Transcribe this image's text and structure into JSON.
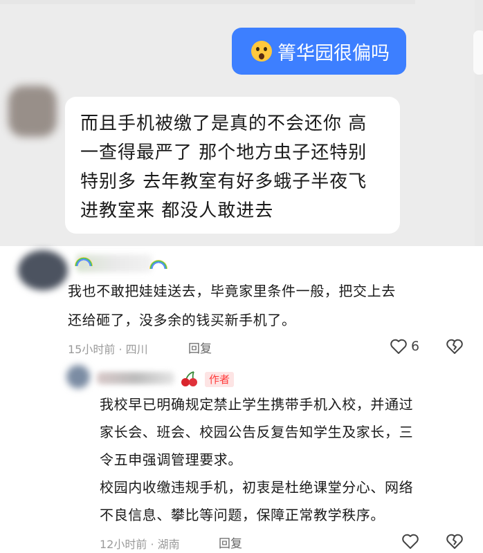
{
  "chat": {
    "outgoing_message": "箐华园很偏吗",
    "incoming_lines": [
      "而且手机被缴了是真的不会还你 高",
      "一查得最严了 那个地方虫子还特别",
      "特别多 去年教室有好多蛾子半夜飞",
      "进教室来 都没人敢进去"
    ]
  },
  "comments": [
    {
      "text_lines": [
        "我也不敢把娃娃送去，毕竟家里条件一般，把交上去",
        "还给砸了，没多余的钱买新手机了。"
      ],
      "time": "15小时前 · 四川",
      "reply_label": "回复",
      "likes": "6"
    },
    {
      "badge": "作者",
      "text_lines": [
        "我校早已明确规定禁止学生携带手机入校，并通过",
        "家长会、班会、校园公告反复告知学生及家长，三",
        "令五申强调管理要求。",
        "校园内收缴违规手机，初衷是杜绝课堂分心、网络",
        "不良信息、攀比等问题，保障正常教学秩序。"
      ],
      "time": "12小时前 · 湖南",
      "reply_label": "回复"
    }
  ],
  "colors": {
    "bubble_blue": "#3d7fff",
    "badge_red": "#ff3b3b",
    "chat_bg": "#ececec"
  },
  "icons": [
    "shocked-emoji-icon",
    "rainbow-icon",
    "cherry-icon",
    "heart-outline-icon",
    "broken-heart-icon"
  ]
}
